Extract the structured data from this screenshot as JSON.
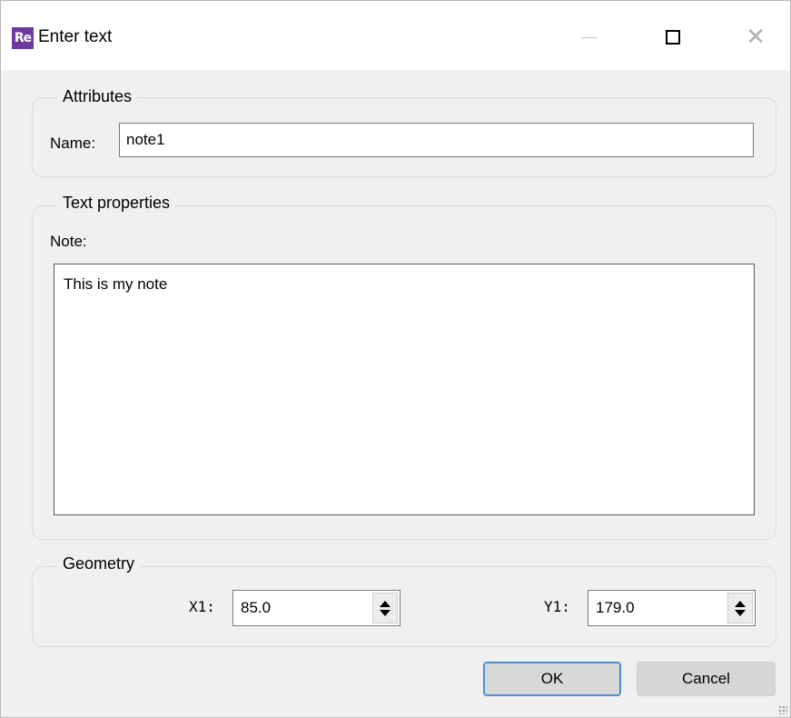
{
  "window": {
    "title": "Enter text",
    "app_icon": "Re"
  },
  "titlebar_buttons": [
    "minimize-icon",
    "maximize-icon",
    "close-icon"
  ],
  "attributes": {
    "title": "Attributes",
    "name_label": "Name:",
    "name_value": "note1"
  },
  "text_properties": {
    "title": "Text properties",
    "note_label": "Note:",
    "note_value": "This is my note"
  },
  "geometry": {
    "title": "Geometry",
    "x1_label": "X1:",
    "x1_value": "85.0",
    "y1_label": "Y1:",
    "y1_value": "179.0"
  },
  "buttons": {
    "ok": "OK",
    "cancel": "Cancel"
  },
  "colors": {
    "accent": "#4a90d9",
    "app_icon": "#6d3a9e"
  }
}
